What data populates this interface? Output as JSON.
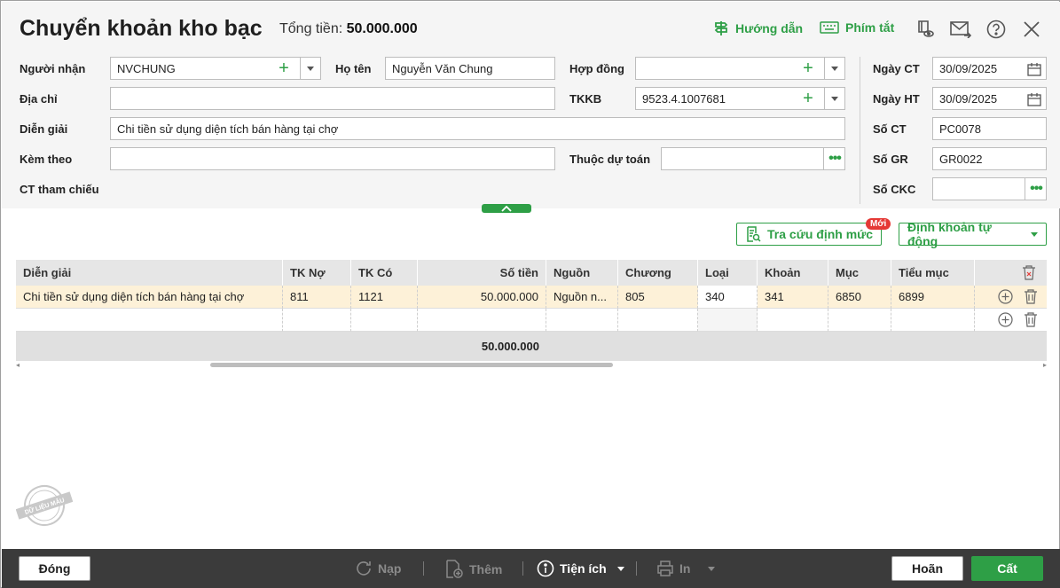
{
  "header": {
    "title": "Chuyển khoản kho bạc",
    "total_label": "Tổng tiền:",
    "total_value": "50.000.000",
    "guide_label": "Hướng dẫn",
    "shortcut_label": "Phím tắt"
  },
  "form": {
    "recipient_label": "Người nhận",
    "recipient_value": "NVCHUNG",
    "fullname_label": "Họ tên",
    "fullname_value": "Nguyễn Văn Chung",
    "contract_label": "Hợp đồng",
    "contract_value": "",
    "address_label": "Địa chỉ",
    "address_value": "",
    "tkkb_label": "TKKB",
    "tkkb_value": "9523.4.1007681",
    "desc_label": "Diễn giải",
    "desc_value": "Chi tiền sử dụng diện tích bán hàng tại chợ",
    "attach_label": "Kèm theo",
    "attach_value": "",
    "budget_label": "Thuộc dự toán",
    "budget_value": "",
    "ref_label": "CT tham chiếu",
    "ct_date_label": "Ngày CT",
    "ct_date_value": "30/09/2025",
    "ht_date_label": "Ngày HT",
    "ht_date_value": "30/09/2025",
    "so_ct_label": "Số CT",
    "so_ct_value": "PC0078",
    "so_gr_label": "Số GR",
    "so_gr_value": "GR0022",
    "so_ckc_label": "Số CKC",
    "so_ckc_value": ""
  },
  "actions": {
    "lookup_label": "Tra cứu định mức",
    "new_badge": "Mới",
    "auto_label": "Định khoản tự động"
  },
  "table": {
    "columns": [
      "Diễn giải",
      "TK Nợ",
      "TK Có",
      "Số tiền",
      "Nguồn",
      "Chương",
      "Loại",
      "Khoản",
      "Mục",
      "Tiểu mục"
    ],
    "row1": [
      "Chi tiền sử dụng diện tích bán hàng tại chợ",
      "811",
      "1121",
      "50.000.000",
      "Nguồn n...",
      "805",
      "340",
      "341",
      "6850",
      "6899"
    ],
    "total": "50.000.000"
  },
  "watermark": "DỮ LIỆU MẪU",
  "footer": {
    "close_label": "Đóng",
    "reload_label": "Nạp",
    "add_label": "Thêm",
    "utility_label": "Tiện ích",
    "print_label": "In",
    "cancel_label": "Hoãn",
    "save_label": "Cất"
  },
  "colors": {
    "accent": "#2e9f46",
    "footer_bg": "#3b3b3b",
    "row_highlight": "#fdf1d8"
  }
}
